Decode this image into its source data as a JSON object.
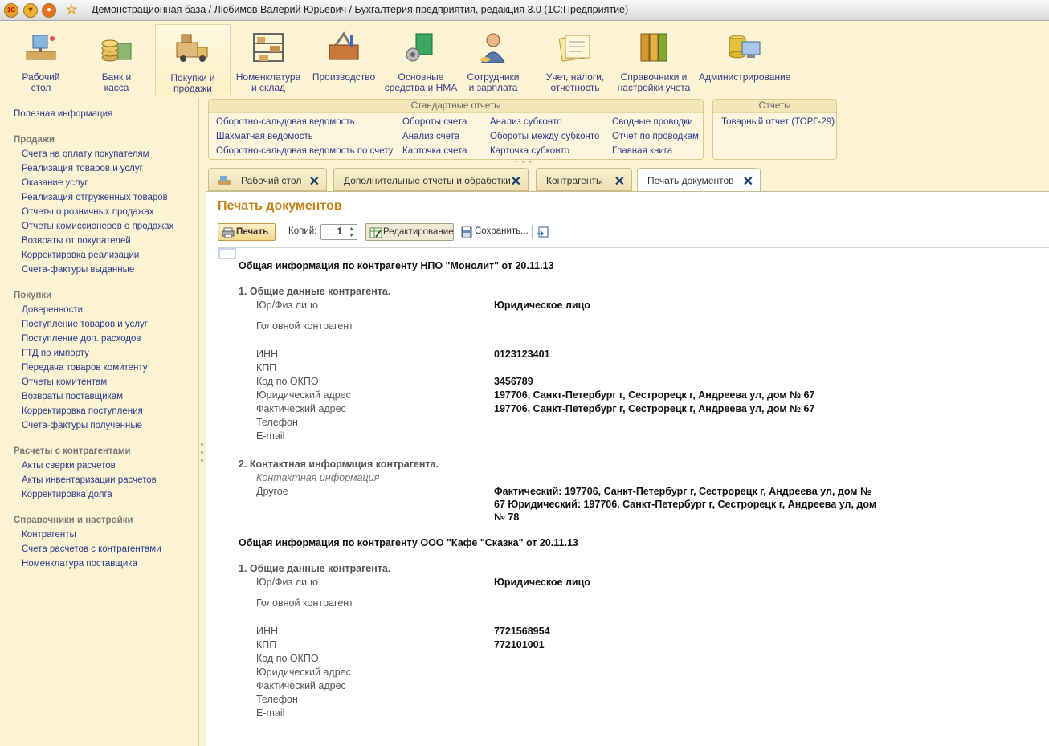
{
  "window": {
    "title": "Демонстрационная база / Любимов Валерий Юрьевич / Бухгалтерия предприятия, редакция 3.0  (1С:Предприятие)"
  },
  "sections": [
    {
      "label_1": "Рабочий",
      "label_2": "стол",
      "icon": "desk-icon"
    },
    {
      "label_1": "Банк и",
      "label_2": "касса",
      "icon": "coins-icon"
    },
    {
      "label_1": "Покупки и",
      "label_2": "продажи",
      "icon": "truck-icon"
    },
    {
      "label_1": "Номенклатура",
      "label_2": "и склад",
      "icon": "warehouse-icon"
    },
    {
      "label_1": "Производство",
      "label_2": "",
      "icon": "toolbox-icon"
    },
    {
      "label_1": "Основные",
      "label_2": "средства и НМА",
      "icon": "assets-icon"
    },
    {
      "label_1": "Сотрудники",
      "label_2": "и зарплата",
      "icon": "employee-icon"
    },
    {
      "label_1": "Учет, налоги,",
      "label_2": "отчетность",
      "icon": "reports-icon"
    },
    {
      "label_1": "Справочники и",
      "label_2": "настройки учета",
      "icon": "binders-icon"
    },
    {
      "label_1": "Администрирование",
      "label_2": "",
      "icon": "admin-icon"
    }
  ],
  "sidebar": {
    "useful": "Полезная информация",
    "groups": [
      {
        "title": "Продажи",
        "items": [
          "Счета на оплату покупателям",
          "Реализация товаров и услуг",
          "Оказание услуг",
          "Реализация отгруженных товаров",
          "Отчеты о розничных продажах",
          "Отчеты комиссионеров о продажах",
          "Возвраты от покупателей",
          "Корректировка реализации",
          "Счета-фактуры выданные"
        ]
      },
      {
        "title": "Покупки",
        "items": [
          "Доверенности",
          "Поступление товаров и услуг",
          "Поступление доп. расходов",
          "ГТД по импорту",
          "Передача товаров комитенту",
          "Отчеты комитентам",
          "Возвраты поставщикам",
          "Корректировка поступления",
          "Счета-фактуры полученные"
        ]
      },
      {
        "title": "Расчеты с контрагентами",
        "items": [
          "Акты сверки расчетов",
          "Акты инвентаризации расчетов",
          "Корректировка долга"
        ]
      },
      {
        "title": "Справочники и настройки",
        "items": [
          "Контрагенты",
          "Счета расчетов с контрагентами",
          "Номенклатура поставщика"
        ]
      }
    ]
  },
  "standard_reports": {
    "title": "Стандартные отчеты",
    "col1": [
      "Оборотно-сальдовая ведомость",
      "Шахматная ведомость",
      "Оборотно-сальдовая ведомость по счету"
    ],
    "col2": [
      "Обороты счета",
      "Анализ счета",
      "Карточка счета"
    ],
    "col3": [
      "Анализ субконто",
      "Обороты между субконто",
      "Карточка субконто"
    ],
    "col4": [
      "Сводные проводки",
      "Отчет по проводкам",
      "Главная книга"
    ]
  },
  "reports": {
    "title": "Отчеты",
    "items": [
      "Товарный отчет (ТОРГ-29)"
    ]
  },
  "tabs": [
    {
      "label": "Рабочий стол"
    },
    {
      "label": "Дополнительные отчеты и обработки"
    },
    {
      "label": "Контрагенты"
    },
    {
      "label": "Печать документов"
    }
  ],
  "form": {
    "title": "Печать документов",
    "print_label": "Печать",
    "copies_label": "Копий:",
    "copies_value": "1",
    "edit_label": "Редактирование",
    "save_label": "Сохранить..."
  },
  "document": {
    "r1": {
      "heading": "Общая информация по контрагенту НПО \"Монолит\" от 20.11.13",
      "sec1": "1. Общие данные контрагента.",
      "legal_type_label": "Юр/Физ лицо",
      "legal_type": "Юридическое лицо",
      "head_label": "Головной контрагент",
      "inn_label": "ИНН",
      "inn": "0123123401",
      "kpp_label": "КПП",
      "okpo_label": "Код по ОКПО",
      "okpo": "3456789",
      "legal_addr_label": "Юридический адрес",
      "legal_addr": "197706, Санкт-Петербург г, Сестрорецк г, Андреева ул, дом № 67",
      "fact_addr_label": "Фактический адрес",
      "fact_addr": "197706, Санкт-Петербург г, Сестрорецк г, Андреева ул, дом № 67",
      "phone_label": "Телефон",
      "email_label": "E-mail",
      "sec2": "2. Контактная информация контрагента.",
      "contact_info": "Контактная информация",
      "other_label": "Другое",
      "other_line1": "Фактический: 197706, Санкт-Петербург г, Сестрорецк г, Андреева ул, дом №",
      "other_line2": "67 Юридический: 197706, Санкт-Петербург г, Сестрорецк г, Андреева ул, дом",
      "other_line3": "№ 78"
    },
    "r2": {
      "heading": "Общая информация по контрагенту ООО \"Кафе \"Сказка\" от 20.11.13",
      "sec1": "1. Общие данные контрагента.",
      "legal_type_label": "Юр/Физ лицо",
      "legal_type": "Юридическое лицо",
      "head_label": "Головной контрагент",
      "inn_label": "ИНН",
      "inn": "7721568954",
      "kpp_label": "КПП",
      "kpp": "772101001",
      "okpo_label": "Код по ОКПО",
      "legal_addr_label": "Юридический адрес",
      "fact_addr_label": "Фактический адрес",
      "phone_label": "Телефон",
      "email_label": "E-mail"
    }
  }
}
